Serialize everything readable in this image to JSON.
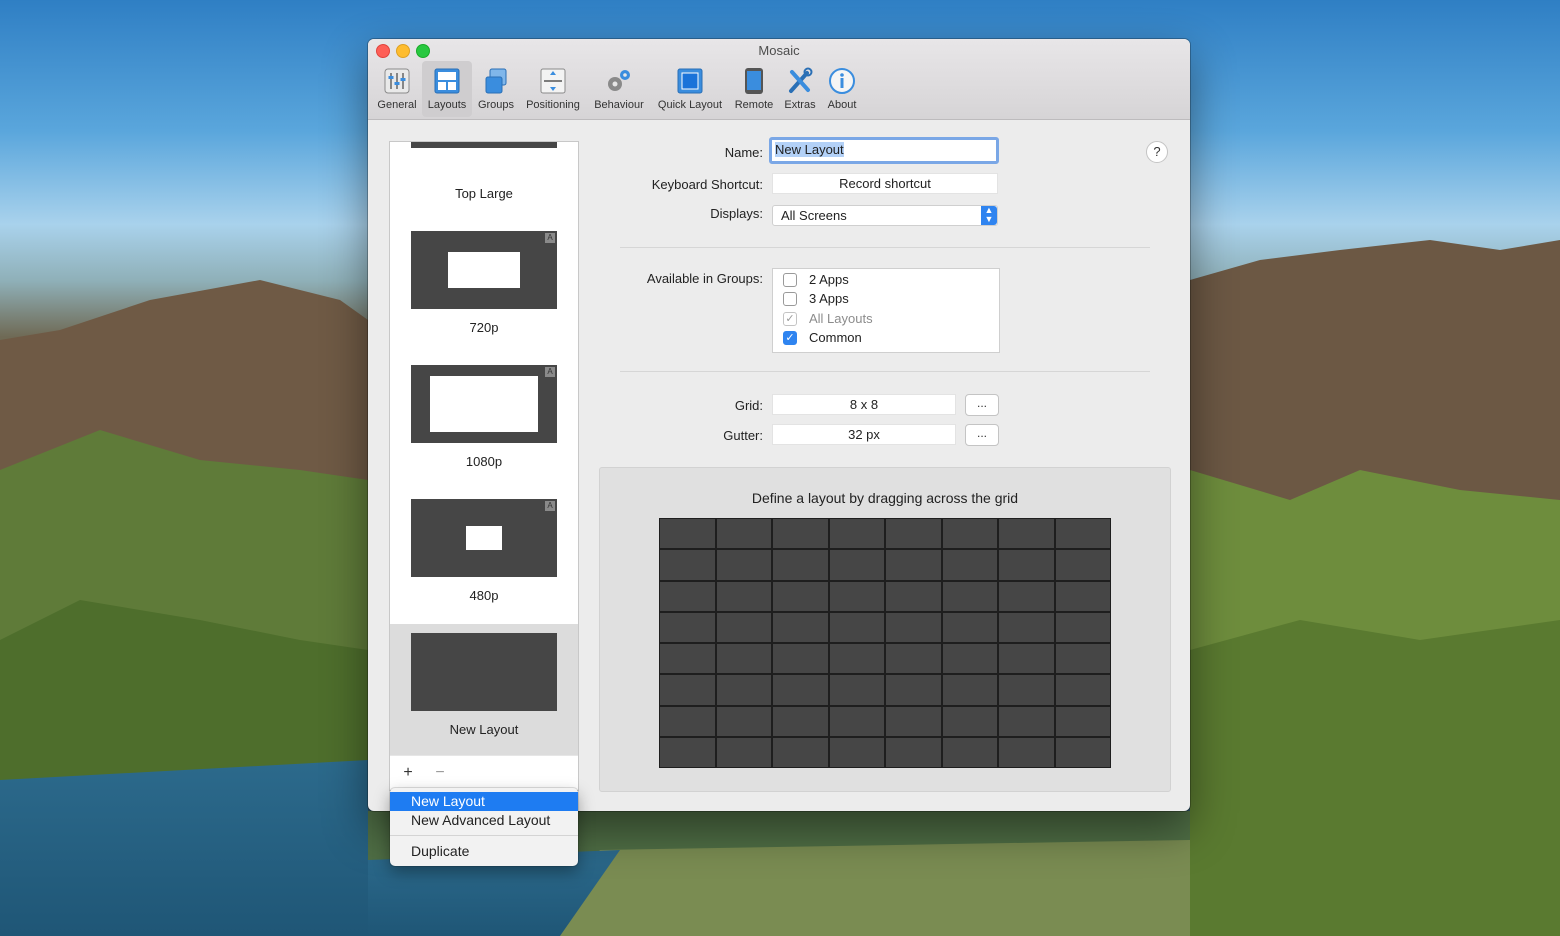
{
  "window": {
    "title": "Mosaic"
  },
  "toolbar": {
    "items": [
      {
        "label": "General",
        "icon": "sliders-icon"
      },
      {
        "label": "Layouts",
        "icon": "layouts-icon",
        "selected": true
      },
      {
        "label": "Groups",
        "icon": "groups-icon"
      },
      {
        "label": "Positioning",
        "icon": "positioning-icon"
      },
      {
        "label": "Behaviour",
        "icon": "gears-icon"
      },
      {
        "label": "Quick Layout",
        "icon": "quick-layout-icon"
      },
      {
        "label": "Remote",
        "icon": "remote-icon"
      },
      {
        "label": "Extras",
        "icon": "tools-icon"
      },
      {
        "label": "About",
        "icon": "info-icon"
      }
    ]
  },
  "sidebar": {
    "items": [
      {
        "label": "Top Large"
      },
      {
        "label": "720p",
        "badge": "A"
      },
      {
        "label": "1080p",
        "badge": "A"
      },
      {
        "label": "480p",
        "badge": "A"
      },
      {
        "label": "New Layout",
        "selected": true
      }
    ],
    "add_label": "+",
    "remove_label": "−"
  },
  "menu": {
    "items": [
      "New Layout",
      "New Advanced Layout",
      "Duplicate"
    ]
  },
  "form": {
    "name_label": "Name:",
    "name_value": "New Layout",
    "shortcut_label": "Keyboard Shortcut:",
    "shortcut_value": "Record shortcut",
    "displays_label": "Displays:",
    "displays_value": "All Screens",
    "groups_label": "Available in Groups:",
    "groups": [
      {
        "label": "2 Apps",
        "checked": false
      },
      {
        "label": "3 Apps",
        "checked": false
      },
      {
        "label": "All Layouts",
        "checked": true,
        "disabled": true
      },
      {
        "label": "Common",
        "checked": true
      }
    ],
    "grid_label": "Grid:",
    "grid_value": "8 x 8",
    "gutter_label": "Gutter:",
    "gutter_value": "32 px",
    "ellipsis_label": "...",
    "help_label": "?"
  },
  "grid_panel": {
    "title": "Define a layout by dragging across the grid",
    "columns": 8,
    "rows": 8
  },
  "colors": {
    "accent": "#2f84f0",
    "menu_highlight": "#1e7cf2",
    "thumb_dark": "#464646"
  }
}
